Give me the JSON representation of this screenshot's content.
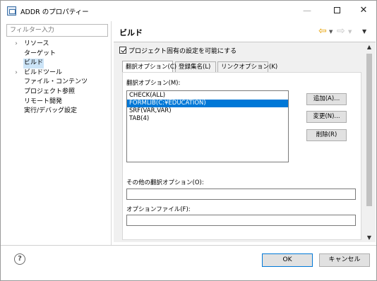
{
  "window": {
    "title": "ADDR のプロパティー",
    "minimize_glyph": "—",
    "close_glyph": "✕"
  },
  "filter": {
    "placeholder": "フィルター入力"
  },
  "tree": {
    "items": [
      {
        "label": "リソース",
        "expander": "›"
      },
      {
        "label": "ターゲット",
        "expander": ""
      },
      {
        "label": "ビルド",
        "expander": "",
        "selected": true
      },
      {
        "label": "ビルドツール",
        "expander": "›"
      },
      {
        "label": "ファイル・コンテンツ",
        "expander": ""
      },
      {
        "label": "プロジェクト参照",
        "expander": ""
      },
      {
        "label": "リモート開発",
        "expander": ""
      },
      {
        "label": "実行/デバッグ設定",
        "expander": ""
      }
    ]
  },
  "page": {
    "title": "ビルド",
    "nav": {
      "back_glyph": "⇦",
      "forward_glyph": "⇨",
      "drop_glyph": "▼",
      "menu_glyph": "▼"
    },
    "project_settings_label": "プロジェクト固有の設定を可能にする",
    "project_settings_checked": true,
    "tabs": [
      {
        "label": "翻訳オプション(C)",
        "active": true
      },
      {
        "label": "登録集名(L)",
        "active": false
      },
      {
        "label": "リンクオプション(K)",
        "active": false
      }
    ],
    "translation_options_label": "翻訳オプション(M):",
    "options": [
      {
        "text": "CHECK(ALL)",
        "selected": false
      },
      {
        "text": "FORMLIB(C:¥EDUCATION)",
        "selected": true
      },
      {
        "text": "SRF(VAR,VAR)",
        "selected": false
      },
      {
        "text": "TAB(4)",
        "selected": false
      }
    ],
    "buttons": {
      "add": "追加(A)...",
      "edit": "変更(N)...",
      "delete": "削除(R)"
    },
    "other_options_label": "その他の翻訳オプション(O):",
    "other_options_value": "",
    "option_file_label": "オプションファイル(F):",
    "option_file_value": ""
  },
  "scroll": {
    "up_glyph": "▲",
    "down_glyph": "▼"
  },
  "footer": {
    "help_glyph": "?",
    "ok": "OK",
    "cancel": "キャンセル"
  }
}
